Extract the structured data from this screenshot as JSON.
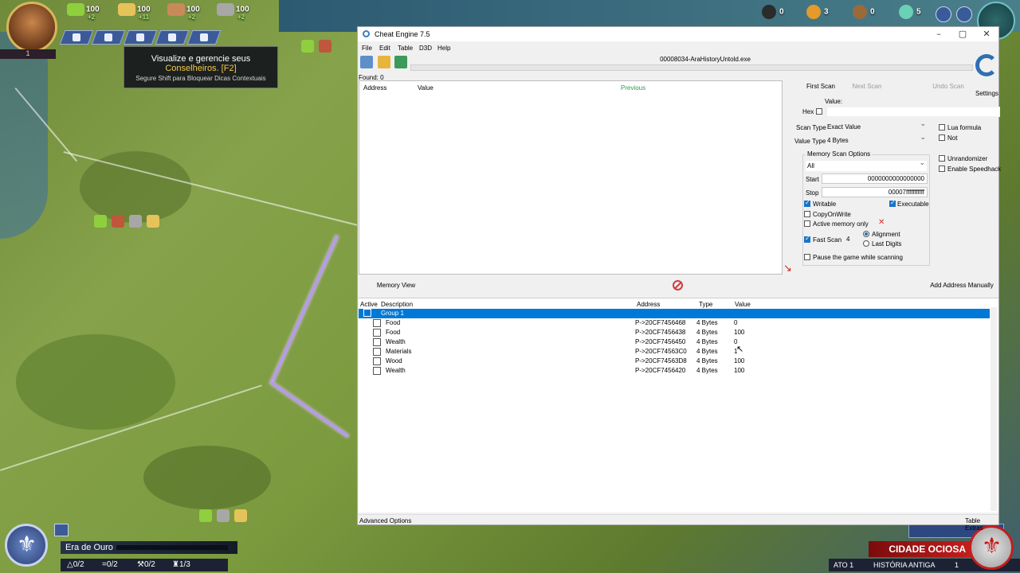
{
  "game": {
    "top_resources": [
      {
        "value": "100",
        "delta": "+2",
        "color": "#8fcf3e"
      },
      {
        "value": "100",
        "delta": "+11",
        "color": "#e6c35a"
      },
      {
        "value": "100",
        "delta": "+2",
        "color": "#c98a5a"
      },
      {
        "value": "100",
        "delta": "+2",
        "color": "#a7a7a7"
      }
    ],
    "leader_level": "1",
    "right_resources": [
      {
        "value": "0",
        "color": "#2b2b2b"
      },
      {
        "value": "3",
        "color": "#e59a2a"
      },
      {
        "value": "0",
        "color": "#9c6a3a"
      },
      {
        "value": "5",
        "color": "#6ad0b6"
      }
    ],
    "tooltip": {
      "line1": "Visualize e gerencie seus",
      "line2": "Conselheiros. [F2]",
      "line3": "Segure Shift para Bloquear Dicas Contextuais"
    },
    "era": {
      "label": "Era de Ouro",
      "stat1": "0/2",
      "stat2": "0/2",
      "stat3": "0/2",
      "stat4": "1/3"
    },
    "city": {
      "banner": "CIDADE OCIOSA",
      "act": "ATO 1",
      "age": "HISTÓRIA ANTIGA",
      "count": "1"
    },
    "icons": {
      "settings": "gear-icon",
      "globe": "globe-icon",
      "emblem": "fleur-de-lis-icon"
    }
  },
  "cheatengine": {
    "title": "Cheat Engine 7.5",
    "menu": [
      "File",
      "Edit",
      "Table",
      "D3D",
      "Help"
    ],
    "process": "00008034-AraHistoryUntold.exe",
    "found": "Found: 0",
    "results_headers": {
      "address": "Address",
      "value": "Value",
      "previous": "Previous"
    },
    "settings_label": "Settings",
    "buttons": {
      "first_scan": "First Scan",
      "next_scan": "Next Scan",
      "undo_scan": "Undo Scan",
      "memory_view": "Memory View",
      "add_address": "Add Address Manually"
    },
    "value_label": "Value:",
    "hex_label": "Hex",
    "scan_type_label": "Scan Type",
    "scan_type_value": "Exact Value",
    "value_type_label": "Value Type",
    "value_type_value": "4 Bytes",
    "lua_formula": "Lua formula",
    "not": "Not",
    "memory_scan_options": "Memory Scan Options",
    "region": "All",
    "start_label": "Start",
    "start_value": "0000000000000000",
    "stop_label": "Stop",
    "stop_value": "00007fffffffffff",
    "writable": "Writable",
    "executable": "Executable",
    "copyonwrite": "CopyOnWrite",
    "active_memory": "Active memory only",
    "fast_scan": "Fast Scan",
    "fast_scan_value": "4",
    "alignment": "Alignment",
    "last_digits": "Last Digits",
    "pause_game": "Pause the game while scanning",
    "unrandomizer": "Unrandomizer",
    "speedhack": "Enable Speedhack",
    "table_headers": {
      "active": "Active",
      "description": "Description",
      "address": "Address",
      "type": "Type",
      "value": "Value"
    },
    "group_label": "Group 1",
    "rows": [
      {
        "desc": "Food",
        "addr": "P->20CF7456468",
        "type": "4 Bytes",
        "value": "0"
      },
      {
        "desc": "Food",
        "addr": "P->20CF7456438",
        "type": "4 Bytes",
        "value": "100"
      },
      {
        "desc": "Wealth",
        "addr": "P->20CF7456450",
        "type": "4 Bytes",
        "value": "0"
      },
      {
        "desc": "Materials",
        "addr": "P->20CF74563C0",
        "type": "4 Bytes",
        "value": "1"
      },
      {
        "desc": "Wood",
        "addr": "P->20CF74563D8",
        "type": "4 Bytes",
        "value": "100"
      },
      {
        "desc": "Wealth",
        "addr": "P->20CF7456420",
        "type": "4 Bytes",
        "value": "100"
      }
    ],
    "advanced_options": "Advanced Options",
    "table_extras": "Table Extras"
  }
}
